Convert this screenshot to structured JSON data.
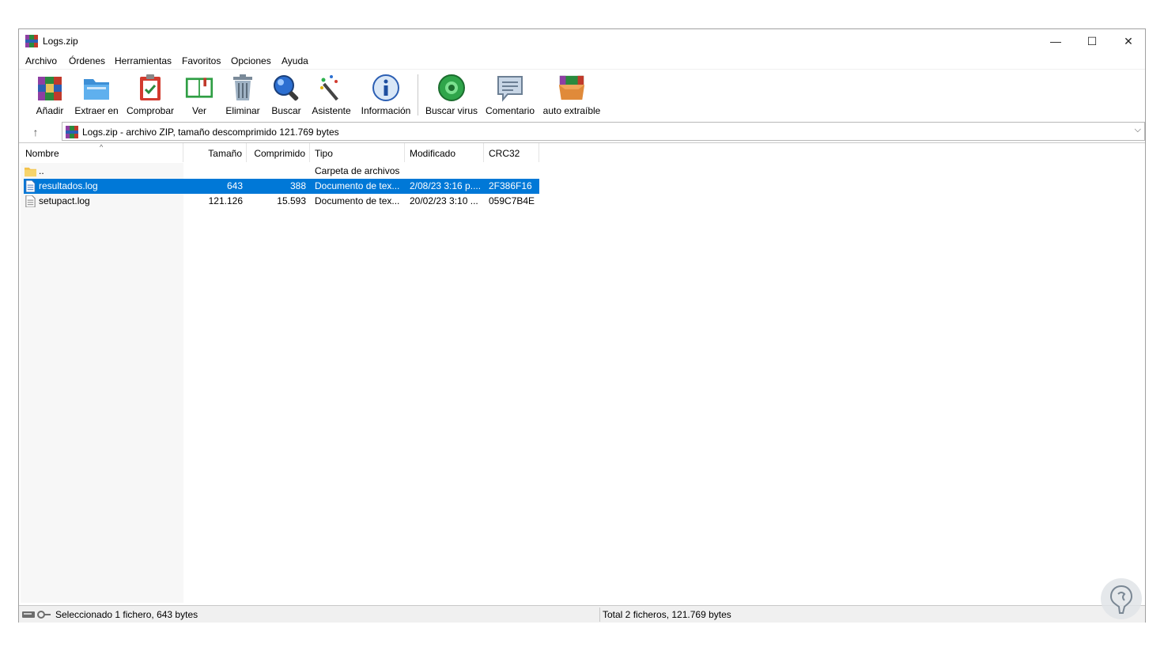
{
  "window": {
    "title": "Logs.zip",
    "controls": {
      "minimize": "—",
      "maximize": "☐",
      "close": "✕"
    }
  },
  "menu": [
    "Archivo",
    "Órdenes",
    "Herramientas",
    "Favoritos",
    "Opciones",
    "Ayuda"
  ],
  "toolbar": [
    {
      "label": "Añadir",
      "icon": "add-archive-icon"
    },
    {
      "label": "Extraer en",
      "icon": "extract-folder-icon"
    },
    {
      "label": "Comprobar",
      "icon": "test-clipboard-icon"
    },
    {
      "label": "Ver",
      "icon": "view-book-icon"
    },
    {
      "label": "Eliminar",
      "icon": "trash-icon"
    },
    {
      "label": "Buscar",
      "icon": "magnifier-icon"
    },
    {
      "label": "Asistente",
      "icon": "wizard-wand-icon"
    },
    {
      "label": "Información",
      "icon": "info-icon"
    },
    {
      "label": "Buscar virus",
      "icon": "virus-scan-icon"
    },
    {
      "label": "Comentario",
      "icon": "comment-icon"
    },
    {
      "label": "auto extraíble",
      "icon": "sfx-box-icon"
    }
  ],
  "address": {
    "up_label": "↑",
    "text": "Logs.zip - archivo ZIP, tamaño descomprimido 121.769 bytes",
    "dropdown": "⌵"
  },
  "list": {
    "sort_indicator": "^",
    "columns": [
      "Nombre",
      "Tamaño",
      "Comprimido",
      "Tipo",
      "Modificado",
      "CRC32"
    ],
    "rows": [
      {
        "name": "..",
        "size": "",
        "packed": "",
        "type": "Carpeta de archivos",
        "modified": "",
        "crc": "",
        "icon": "folder-up-icon",
        "selected": false
      },
      {
        "name": "resultados.log",
        "size": "643",
        "packed": "388",
        "type": "Documento de tex...",
        "modified": "2/08/23 3:16 p....",
        "crc": "2F386F16",
        "icon": "text-file-icon",
        "selected": true
      },
      {
        "name": "setupact.log",
        "size": "121.126",
        "packed": "15.593",
        "type": "Documento de tex...",
        "modified": "20/02/23 3:10 ...",
        "crc": "059C7B4E",
        "icon": "text-file-icon",
        "selected": false
      }
    ]
  },
  "status": {
    "left": "Seleccionado 1 fichero, 643 bytes",
    "right": "Total 2 ficheros, 121.769 bytes"
  },
  "colors": {
    "selection": "#0078d7",
    "folder": "#f3c24a"
  }
}
